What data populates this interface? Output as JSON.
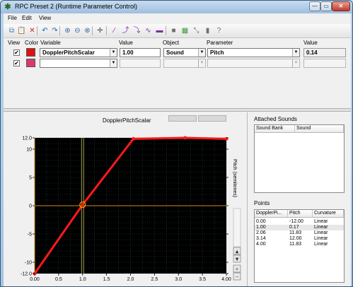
{
  "window": {
    "title": "RPC Preset 2 (Runtime Parameter Control)",
    "controls": {
      "minimize": "—",
      "maximize": "▭",
      "close": "✕"
    }
  },
  "menu": {
    "items": [
      "File",
      "Edit",
      "View"
    ]
  },
  "toolbar": {
    "icons": [
      "copy-icon",
      "paste-icon",
      "delete-icon",
      "undo-icon",
      "redo-icon",
      "zoom-in-icon",
      "zoom-out-icon",
      "zoom-reset-icon",
      "add-point-icon",
      "curve-linear-icon",
      "curve-fast-icon",
      "curve-slow-icon",
      "curve-sincos-icon",
      "curve-step-icon",
      "grid-icon",
      "snap-icon",
      "fit-icon",
      "info-icon",
      "help-icon"
    ],
    "glyphs": [
      "⧉",
      "📋",
      "✕",
      "↶",
      "↷",
      "⊕",
      "⊖",
      "⊗",
      "✛",
      "∕",
      "⤴",
      "⤵",
      "∿",
      "▬",
      "■",
      "▦",
      "⤡",
      "▮",
      "?"
    ],
    "colors": [
      "#4a7fb5",
      "#b88a2a",
      "#d02020",
      "#2060b0",
      "#2060b0",
      "#3a6ea8",
      "#3a6ea8",
      "#3a6ea8",
      "#444444",
      "#7a2bb0",
      "#7a2bb0",
      "#7a2bb0",
      "#7a2bb0",
      "#7a2bb0",
      "#707070",
      "#3a9a3a",
      "#707070",
      "#707070",
      "#707070"
    ]
  },
  "rows": {
    "headers": {
      "view": "View",
      "color": "Color",
      "variable": "Variable",
      "value": "Value",
      "object": "Object",
      "parameter": "Parameter",
      "value2": "Value"
    },
    "row1": {
      "checked": "✔",
      "color": "#e01010",
      "variable": "DopplerPitchScalar",
      "value": "1.00",
      "object": "Sound",
      "parameter": "Pitch",
      "param_value": "0.14"
    },
    "row2": {
      "checked": "✔",
      "color": "#d83a6a",
      "variable": "",
      "value": "",
      "object": "",
      "parameter": "",
      "param_value": ""
    }
  },
  "graph": {
    "title": "DopplerPitchScalar",
    "y_axis_label": "Pitch (semitones)",
    "y_ticks": [
      "12.0",
      "10",
      "5",
      "0",
      "-5",
      "-10",
      "-12.0"
    ],
    "x_ticks": [
      "0.00",
      "0.5",
      "1.0",
      "1.5",
      "2.0",
      "2.5",
      "3.0",
      "3.5",
      "4.00"
    ],
    "scroll_up": "▲",
    "scroll_down": "▼",
    "zoom_buttons": [
      "+",
      "−"
    ]
  },
  "chart_data": {
    "type": "line",
    "title": "DopplerPitchScalar",
    "xlabel": "",
    "ylabel": "Pitch (semitones)",
    "xlim": [
      0,
      4
    ],
    "ylim": [
      -12,
      12
    ],
    "grid": true,
    "current_x": 1.0,
    "series": [
      {
        "color": "#ff1a1a",
        "x": [
          0.0,
          1.0,
          2.06,
          3.14,
          4.0
        ],
        "y": [
          -12.0,
          0.17,
          11.83,
          12.0,
          11.83
        ]
      }
    ]
  },
  "attached_sounds": {
    "label": "Attached Sounds",
    "columns": [
      "Sound Bank",
      "Sound"
    ],
    "rows": []
  },
  "points": {
    "label": "Points",
    "columns": [
      "DopplerPi...",
      "Pitch",
      "Curvature"
    ],
    "rows": [
      [
        "0.00",
        "-12.00",
        "Linear"
      ],
      [
        "1.00",
        "0.17",
        "Linear"
      ],
      [
        "2.06",
        "11.83",
        "Linear"
      ],
      [
        "3.14",
        "12.00",
        "Linear"
      ],
      [
        "4.00",
        "11.83",
        "Linear"
      ]
    ]
  }
}
